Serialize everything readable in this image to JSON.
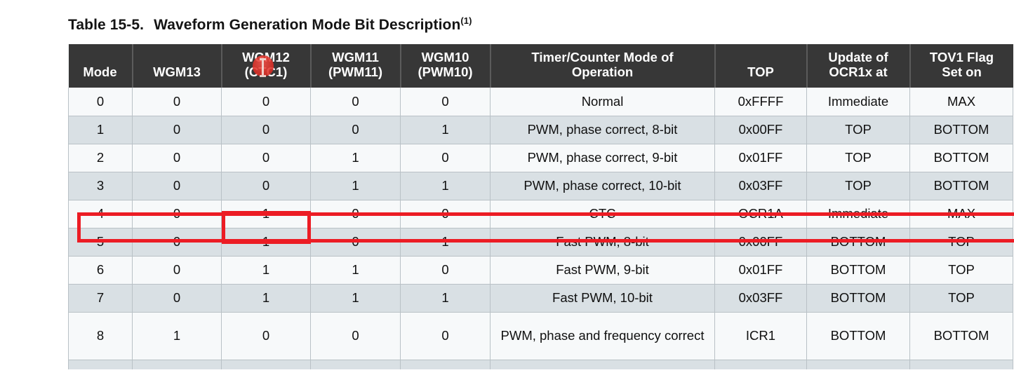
{
  "caption": {
    "label": "Table 15-5.",
    "title": "Waveform Generation Mode Bit Description",
    "footnote_ref": "(1)"
  },
  "table": {
    "columns": [
      {
        "key": "mode",
        "label": "Mode",
        "line1": "Mode",
        "line2": ""
      },
      {
        "key": "wgm13",
        "label": "WGM13",
        "line1": "WGM13",
        "line2": ""
      },
      {
        "key": "wgm12",
        "label": "WGM12 (CTC1)",
        "line1": "WGM12",
        "line2": "(CTC1)"
      },
      {
        "key": "wgm11",
        "label": "WGM11 (PWM11)",
        "line1": "WGM11",
        "line2": "(PWM11)"
      },
      {
        "key": "wgm10",
        "label": "WGM10 (PWM10)",
        "line1": "WGM10",
        "line2": "(PWM10)"
      },
      {
        "key": "oper",
        "label": "Timer/Counter Mode of Operation",
        "line1": "Timer/Counter Mode of",
        "line2": "Operation"
      },
      {
        "key": "top",
        "label": "TOP",
        "line1": "TOP",
        "line2": ""
      },
      {
        "key": "upd",
        "label": "Update of OCR1x at",
        "line1": "Update of",
        "line2": "OCR1x at"
      },
      {
        "key": "tov",
        "label": "TOV1 Flag Set on",
        "line1": "TOV1 Flag",
        "line2": "Set on"
      }
    ],
    "rows": [
      {
        "mode": "0",
        "wgm13": "0",
        "wgm12": "0",
        "wgm11": "0",
        "wgm10": "0",
        "oper": "Normal",
        "top": "0xFFFF",
        "upd": "Immediate",
        "tov": "MAX",
        "shade": "odd",
        "tall": false,
        "highlighted": false
      },
      {
        "mode": "1",
        "wgm13": "0",
        "wgm12": "0",
        "wgm11": "0",
        "wgm10": "1",
        "oper": "PWM, phase correct, 8-bit",
        "top": "0x00FF",
        "upd": "TOP",
        "tov": "BOTTOM",
        "shade": "even",
        "tall": false,
        "highlighted": false
      },
      {
        "mode": "2",
        "wgm13": "0",
        "wgm12": "0",
        "wgm11": "1",
        "wgm10": "0",
        "oper": "PWM, phase correct, 9-bit",
        "top": "0x01FF",
        "upd": "TOP",
        "tov": "BOTTOM",
        "shade": "odd",
        "tall": false,
        "highlighted": false
      },
      {
        "mode": "3",
        "wgm13": "0",
        "wgm12": "0",
        "wgm11": "1",
        "wgm10": "1",
        "oper": "PWM, phase correct, 10-bit",
        "top": "0x03FF",
        "upd": "TOP",
        "tov": "BOTTOM",
        "shade": "even",
        "tall": false,
        "highlighted": false
      },
      {
        "mode": "4",
        "wgm13": "0",
        "wgm12": "1",
        "wgm11": "0",
        "wgm10": "0",
        "oper": "CTC",
        "top": "OCR1A",
        "upd": "Immediate",
        "tov": "MAX",
        "shade": "odd",
        "tall": false,
        "highlighted": true
      },
      {
        "mode": "5",
        "wgm13": "0",
        "wgm12": "1",
        "wgm11": "0",
        "wgm10": "1",
        "oper": "Fast PWM, 8-bit",
        "top": "0x00FF",
        "upd": "BOTTOM",
        "tov": "TOP",
        "shade": "even",
        "tall": false,
        "highlighted": false
      },
      {
        "mode": "6",
        "wgm13": "0",
        "wgm12": "1",
        "wgm11": "1",
        "wgm10": "0",
        "oper": "Fast PWM, 9-bit",
        "top": "0x01FF",
        "upd": "BOTTOM",
        "tov": "TOP",
        "shade": "odd",
        "tall": false,
        "highlighted": false
      },
      {
        "mode": "7",
        "wgm13": "0",
        "wgm12": "1",
        "wgm11": "1",
        "wgm10": "1",
        "oper": "Fast PWM, 10-bit",
        "top": "0x03FF",
        "upd": "BOTTOM",
        "tov": "TOP",
        "shade": "even",
        "tall": false,
        "highlighted": false
      },
      {
        "mode": "8",
        "wgm13": "1",
        "wgm12": "0",
        "wgm11": "0",
        "wgm10": "0",
        "oper": "PWM, phase and frequency correct",
        "top": "ICR1",
        "upd": "BOTTOM",
        "tov": "BOTTOM",
        "shade": "odd",
        "tall": true,
        "highlighted": false
      },
      {
        "mode": "",
        "wgm13": "",
        "wgm12": "",
        "wgm11": "",
        "wgm10": "",
        "oper": "",
        "top": "",
        "upd": "",
        "tov": "",
        "shade": "even",
        "tall": false,
        "highlighted": false,
        "clipped": true
      }
    ]
  },
  "annotations": {
    "highlight_color": "#ec1c24",
    "row_highlight_label": "Mode 4 row highlight",
    "cell_highlight_label": "WGM12 (CTC1) cell highlight for mode 4",
    "cursor_label": "text cursor over WGM12 header"
  },
  "colors": {
    "header_background": "#373737",
    "header_text": "#ffffff",
    "row_odd": "#f7f9fa",
    "row_even": "#d9e0e4",
    "grid_line": "#b9c1c6",
    "body_text": "#101010",
    "page_background": "#ffffff"
  }
}
